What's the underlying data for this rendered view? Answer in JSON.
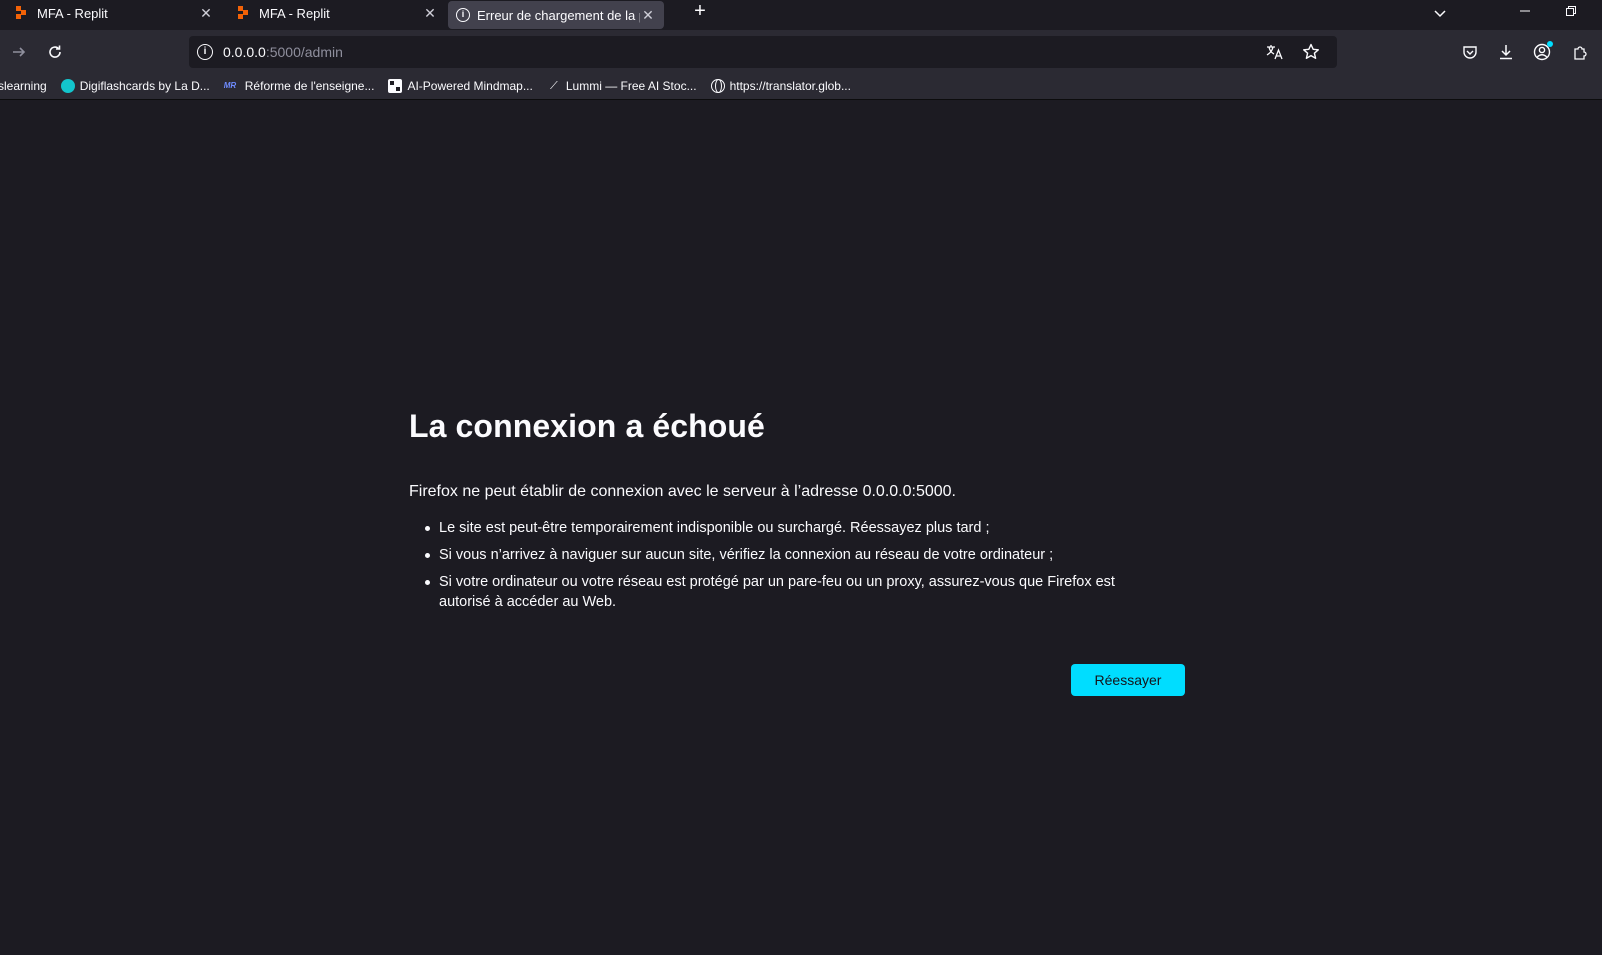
{
  "tabs": [
    {
      "title": "MFA - Replit",
      "icon": "replit-icon"
    },
    {
      "title": "MFA - Replit",
      "icon": "replit-icon"
    },
    {
      "title": "Erreur de chargement de la pag",
      "icon": "info-icon",
      "active": true
    }
  ],
  "urlbar": {
    "host": "0.0.0.0",
    "path": ":5000/admin"
  },
  "bookmarks": [
    {
      "label": "slearning"
    },
    {
      "label": "Digiflashcards by La D..."
    },
    {
      "label": "Réforme de l'enseigne..."
    },
    {
      "label": "AI-Powered Mindmap..."
    },
    {
      "label": "Lummi — Free AI Stoc..."
    },
    {
      "label": "https://translator.glob..."
    }
  ],
  "error": {
    "title": "La connexion a échoué",
    "description": "Firefox ne peut établir de connexion avec le serveur à l’adresse 0.0.0.0:5000.",
    "items": [
      "Le site est peut-être temporairement indisponible ou surchargé. Réessayez plus tard ;",
      "Si vous n’arrivez à naviguer sur aucun site, vérifiez la connexion au réseau de votre ordinateur ;",
      "Si votre ordinateur ou votre réseau est protégé par un pare-feu ou un proxy, assurez-vous que Firefox est autorisé à accéder au Web."
    ],
    "retry_label": "Réessayer"
  },
  "colors": {
    "page_bg": "#1c1b22",
    "toolbar_bg": "#2b2a33",
    "accent": "#00ddff"
  }
}
